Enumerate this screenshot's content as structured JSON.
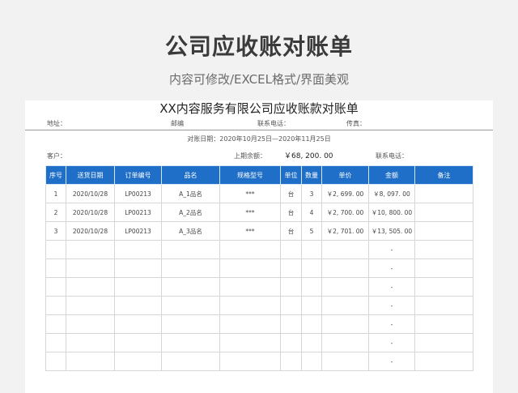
{
  "banner": {
    "title": "公司应收账对账单",
    "subtitle": "内容可修改/EXCEL格式/界面美观"
  },
  "document": {
    "title": "XX内容服务有限公司应收账款对账单",
    "address_label": "地址：",
    "zip_label": "邮编",
    "phone_label": "联系电话：",
    "fax_label": "传真：",
    "period": "对账日期：2020年10月25日—2020年11月25日",
    "customer_label": "客户：",
    "prev_balance_label": "上期余额：",
    "prev_balance_value": "￥68, 200. 00",
    "contact_phone_label": "联系电话："
  },
  "table": {
    "headers": [
      "序号",
      "送货日期",
      "订单编号",
      "品名",
      "规格型号",
      "单位",
      "数量",
      "单价",
      "金额",
      "备注"
    ],
    "rows": [
      [
        "1",
        "2020/10/28",
        "LP00213",
        "A_1品名",
        "***",
        "台",
        "3",
        "￥2, 699. 00",
        "￥8, 097. 00",
        ""
      ],
      [
        "2",
        "2020/10/28",
        "LP00213",
        "A_2品名",
        "***",
        "台",
        "4",
        "￥2, 700. 00",
        "￥10, 800. 00",
        ""
      ],
      [
        "3",
        "2020/10/28",
        "LP00213",
        "A_3品名",
        "***",
        "台",
        "5",
        "￥2, 701. 00",
        "￥13, 505. 00",
        ""
      ],
      [
        "",
        "",
        "",
        "",
        "",
        "",
        "",
        "",
        "-",
        ""
      ],
      [
        "",
        "",
        "",
        "",
        "",
        "",
        "",
        "",
        "-",
        ""
      ],
      [
        "",
        "",
        "",
        "",
        "",
        "",
        "",
        "",
        "-",
        ""
      ],
      [
        "",
        "",
        "",
        "",
        "",
        "",
        "",
        "",
        "-",
        ""
      ],
      [
        "",
        "",
        "",
        "",
        "",
        "",
        "",
        "",
        "-",
        ""
      ],
      [
        "",
        "",
        "",
        "",
        "",
        "",
        "",
        "",
        "-",
        ""
      ],
      [
        "",
        "",
        "",
        "",
        "",
        "",
        "",
        "",
        "-",
        ""
      ]
    ]
  }
}
